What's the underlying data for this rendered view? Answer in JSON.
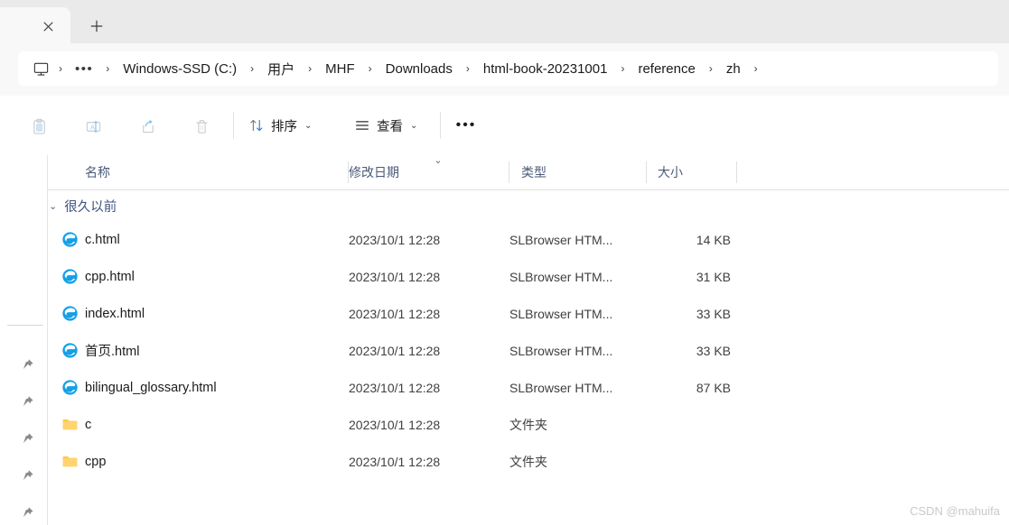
{
  "tabs": {
    "close_label": "✕",
    "new_tab_label": "+"
  },
  "address": {
    "pc_icon": "monitor-icon",
    "overflow_label": "•••",
    "separator": "›",
    "crumbs": [
      "Windows-SSD (C:)",
      "用户",
      "MHF",
      "Downloads",
      "html-book-20231001",
      "reference",
      "zh"
    ]
  },
  "toolbar": {
    "paste_icon": "paste-icon",
    "rename_icon": "rename-icon",
    "share_icon": "share-icon",
    "delete_icon": "delete-icon",
    "sort_label": "排序",
    "view_label": "查看",
    "chevron": "⌄",
    "more_label": "•••"
  },
  "navpane": {
    "pin_icon": "pin-icon",
    "pin_count": 5
  },
  "columns": {
    "name": "名称",
    "date": "修改日期",
    "type": "类型",
    "size": "大小",
    "sort_indicator": "⌄"
  },
  "group": {
    "chevron": "⌄",
    "label": "很久以前"
  },
  "files": [
    {
      "name": "c.html",
      "date": "2023/10/1 12:28",
      "type": "SLBrowser HTM...",
      "size": "14 KB",
      "icon": "edge-html-icon"
    },
    {
      "name": "cpp.html",
      "date": "2023/10/1 12:28",
      "type": "SLBrowser HTM...",
      "size": "31 KB",
      "icon": "edge-html-icon"
    },
    {
      "name": "index.html",
      "date": "2023/10/1 12:28",
      "type": "SLBrowser HTM...",
      "size": "33 KB",
      "icon": "edge-html-icon"
    },
    {
      "name": "首页.html",
      "date": "2023/10/1 12:28",
      "type": "SLBrowser HTM...",
      "size": "33 KB",
      "icon": "edge-html-icon"
    },
    {
      "name": "bilingual_glossary.html",
      "date": "2023/10/1 12:28",
      "type": "SLBrowser HTM...",
      "size": "87 KB",
      "icon": "edge-html-icon"
    },
    {
      "name": "c",
      "date": "2023/10/1 12:28",
      "type": "文件夹",
      "size": "",
      "icon": "folder-icon"
    },
    {
      "name": "cpp",
      "date": "2023/10/1 12:28",
      "type": "文件夹",
      "size": "",
      "icon": "folder-icon"
    }
  ],
  "watermark": "CSDN @mahuifa",
  "colors": {
    "tabstrip_bg": "#eaeaea",
    "address_bg": "#f8f8f8",
    "header_text": "#4a5b7a",
    "group_text": "#3f5280",
    "folder": "#ffc95c",
    "edge_blue": "#1b9de2"
  }
}
